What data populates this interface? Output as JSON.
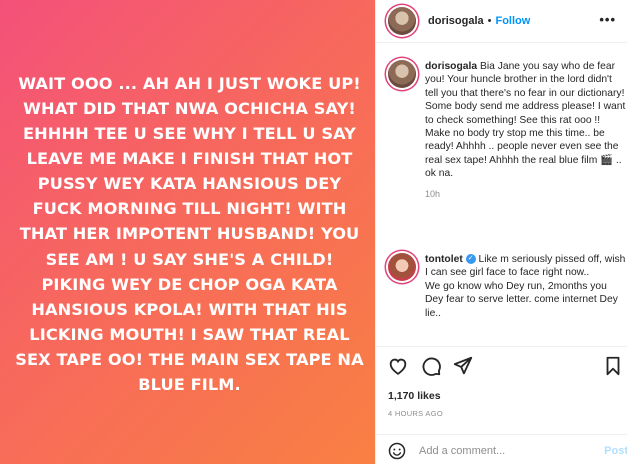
{
  "media": {
    "text": "WAIT OOO ... AH AH I JUST WOKE UP! WHAT DID THAT NWA OCHICHA SAY! EHHHH TEE U SEE WHY I TELL U SAY LEAVE ME MAKE I FINISH THAT HOT PUSSY WEY KATA HANSIOUS DEY FUCK MORNING TILL NIGHT! WITH THAT HER IMPOTENT HUSBAND! YOU SEE AM ! U SAY SHE'S A CHILD! PIKING WEY DE CHOP OGA KATA HANSIOUS KPOLA! WITH THAT HIS LICKING MOUTH! I SAW THAT REAL SEX TAPE OO! THE MAIN SEX TAPE NA BLUE FILM."
  },
  "header": {
    "username": "dorisogala",
    "dot": "•",
    "follow_label": "Follow",
    "more_icon": "more-horizontal-icon"
  },
  "caption": {
    "username": "dorisogala",
    "text": "Bia Jane you say who de fear you! Your huncle brother in the lord didn't tell you that there's no fear in our dictionary! Some body send me address please! I want to check something! See this rat ooo !! Make no body try stop me this time.. be ready! Ahhhh .. people never even see the real sex tape! Ahhhh the real blue film 🎬 .. ok na.",
    "time": "10h"
  },
  "comment": {
    "username": "tontolet",
    "verified_icon": "verified-badge-icon",
    "text": "Like m seriously pissed off, wish I can see girl face to face right now..\nWe go know who Dey run, 2months you Dey fear to serve letter. come internet Dey lie.."
  },
  "actions": {
    "like_icon": "heart-icon",
    "comment_icon": "comment-icon",
    "share_icon": "share-icon",
    "save_icon": "bookmark-icon"
  },
  "likes": "1,170 likes",
  "posted_ago": "4 HOURS AGO",
  "add_comment": {
    "placeholder": "Add a comment...",
    "post_label": "Post",
    "emoji_icon": "smiley-icon"
  },
  "colors": {
    "follow": "#0095f6",
    "gradient_start": "#f4517a",
    "gradient_end": "#f98043"
  }
}
